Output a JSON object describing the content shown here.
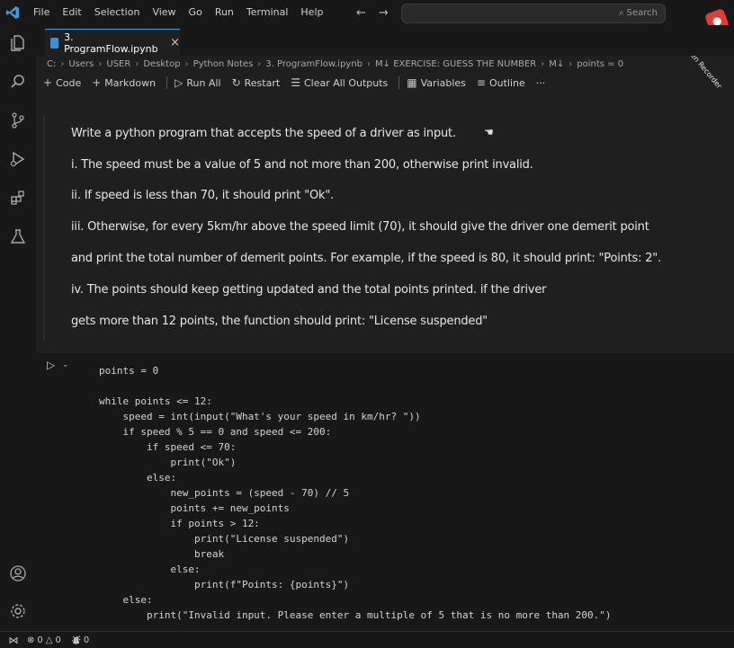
{
  "menu": [
    "File",
    "Edit",
    "Selection",
    "View",
    "Go",
    "Run",
    "Terminal",
    "Help"
  ],
  "search": {
    "placeholder": "Search"
  },
  "recorder": {
    "label": "iTop Screen Recorder"
  },
  "activity_icons": [
    "explorer-icon",
    "search-icon",
    "source-control-icon",
    "run-debug-icon",
    "extensions-icon",
    "testing-icon",
    "accounts-icon",
    "settings-icon"
  ],
  "tab": {
    "label": "3. ProgramFlow.ipynb",
    "close": "×"
  },
  "breadcrumb": [
    "C:",
    "Users",
    "USER",
    "Desktop",
    "Python Notes",
    "3. ProgramFlow.ipynb",
    "M↓ EXERCISE: GUESS THE NUMBER",
    "M↓",
    "points = 0"
  ],
  "toolbar": {
    "code": "Code",
    "markdown": "Markdown",
    "run_all": "Run All",
    "restart": "Restart",
    "clear": "Clear All Outputs",
    "variables": "Variables",
    "outline": "Outline",
    "more": "···"
  },
  "markdown": {
    "line1": "Write a python program that accepts the speed of a driver as input.",
    "line2": "i. The speed must be a value of 5 and not more than 200, otherwise print invalid.",
    "line3": "ii. If speed is less than 70, it should print \"Ok\".",
    "line4": "iii. Otherwise, for every 5km/hr above the speed limit (70), it should give the driver one demerit point",
    "line5": "and print the total number of demerit points. For example, if the speed is 80, it should print: \"Points: 2\".",
    "line6": "iv. The points should keep getting updated and the total points printed. if the driver",
    "line7": "gets more than 12 points, the function should print: \"License suspended\""
  },
  "code": {
    "l01": "points = 0",
    "l02": "",
    "l03": "while points <= 12:",
    "l04": "    speed = int(input(\"What's your speed in km/hr? \"))",
    "l05": "    if speed % 5 == 0 and speed <= 200:",
    "l06": "        if speed <= 70:",
    "l07": "            print(\"Ok\")",
    "l08": "        else:",
    "l09": "            new_points = (speed - 70) // 5",
    "l10": "            points += new_points",
    "l11": "            if points > 12:",
    "l12": "                print(\"License suspended\")",
    "l13": "                break",
    "l14": "            else:",
    "l15": "                print(f\"Points: {points}\")",
    "l16": "    else:",
    "l17": "        print(\"Invalid input. Please enter a multiple of 5 that is no more than 200.\")"
  },
  "status": {
    "errors": "0",
    "warnings": "0",
    "ports": "0"
  },
  "colors": {
    "accent": "#3b9ce8",
    "background": "#1f1f1f"
  }
}
